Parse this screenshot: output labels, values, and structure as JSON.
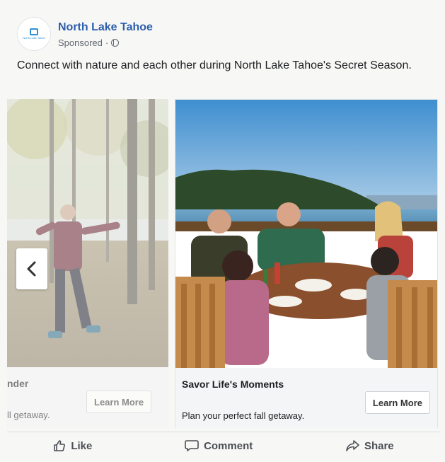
{
  "post": {
    "page_name": "North Lake Tahoe",
    "sponsored_label": "Sponsored",
    "separator": "·",
    "logo_text": "North Lake Tahoe",
    "privacy_icon": "globe-icon",
    "text": "Connect with nature and each other during North Lake Tahoe's Secret Season."
  },
  "carousel": {
    "prev_icon": "chevron-left-icon",
    "cards": [
      {
        "title": "nder",
        "description": "ll getaway.",
        "cta": "Learn More"
      },
      {
        "title": "Savor Life's Moments",
        "description": "Plan your perfect fall getaway.",
        "cta": "Learn More"
      }
    ]
  },
  "actions": {
    "like": "Like",
    "comment": "Comment",
    "share": "Share"
  },
  "colors": {
    "brand_blue": "#2d5fab",
    "logo_blue": "#2f8fd0",
    "text": "#1c1e21",
    "muted": "#606770"
  }
}
